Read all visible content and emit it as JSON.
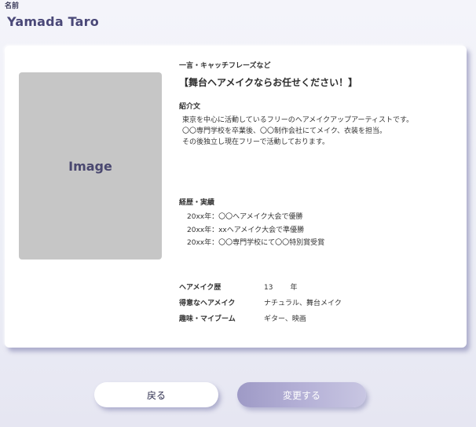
{
  "profile": {
    "name_label": "名前",
    "name": "Yamada Taro"
  },
  "card": {
    "image_label": "Image",
    "catchphrase_label": "一言・キャッチフレーズなど",
    "catchphrase": "【舞台ヘアメイクならお任せください！】",
    "intro_label": "紹介文",
    "intro_lines": [
      "東京を中心に活動しているフリーのヘアメイクアップアーティストです。",
      "〇〇専門学校を卒業後、〇〇制作会社にてメイク、衣装を担当。",
      "その後独立し現在フリーで活動しております。"
    ],
    "career_label": "経歴・実績",
    "career_items": [
      "20xx年：〇〇ヘアメイク大会で優勝",
      "20xx年：xxヘアメイク大会で準優勝",
      "20xx年：〇〇専門学校にて〇〇特別賞受賞"
    ],
    "details": {
      "experience_label": "ヘアメイク歴",
      "experience_value": "13",
      "experience_unit": "年",
      "specialty_label": "得意なヘアメイク",
      "specialty_value": "ナチュラル、舞台メイク",
      "hobby_label": "趣味・マイブーム",
      "hobby_value": "ギター、映画"
    }
  },
  "buttons": {
    "back_label": "戻る",
    "change_label": "変更する"
  },
  "colors": {
    "accent": "#4a4878",
    "change_button": "#b4b0d6",
    "image_placeholder": "#c6c6c6"
  }
}
